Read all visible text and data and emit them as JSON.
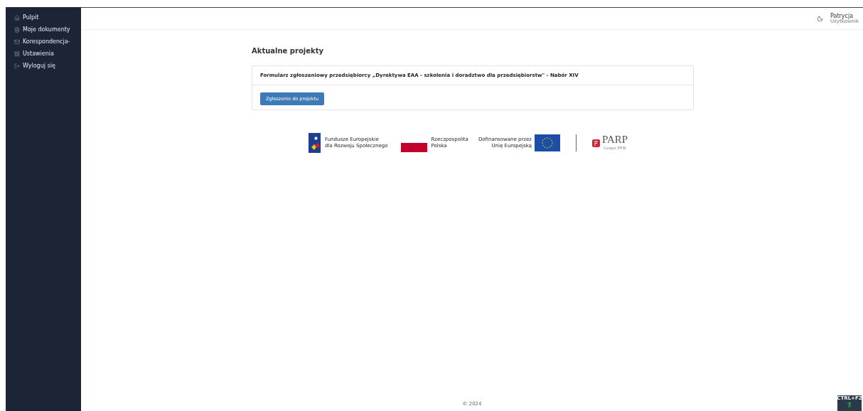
{
  "sidebar": {
    "items": [
      {
        "label": "Pulpit",
        "selected": false
      },
      {
        "label": "Moje dokumenty",
        "selected": false
      },
      {
        "label": "Korespondencja-",
        "selected": false
      },
      {
        "label": "Ustawienia",
        "selected": false
      },
      {
        "label": "Wyloguj się",
        "selected": false
      }
    ]
  },
  "header": {
    "user_name": "Patrycja",
    "user_role": "Użytkownik"
  },
  "section_title": "Aktualne projekty",
  "projects": [
    {
      "title": "Formularz zgłoszeniowy przedsiębiorcy „Dyrektywa EAA - szkolenia i doradztwo dla przedsiębiorstw\" - Nabór XIV",
      "button": "Zgłoszenie do projektu"
    }
  ],
  "logos": {
    "fe": [
      "Fundusze Europejskie",
      "dla Rozwoju Społecznego"
    ],
    "rp": [
      "Rzeczpospolita",
      "Polska"
    ],
    "eu": [
      "Dofinansowane przez",
      "Unię Europejską"
    ],
    "parp": "PARP",
    "parp_sub": "Grupa PFR"
  },
  "footer": "© 2024",
  "shortcut": "CTRL+F2"
}
